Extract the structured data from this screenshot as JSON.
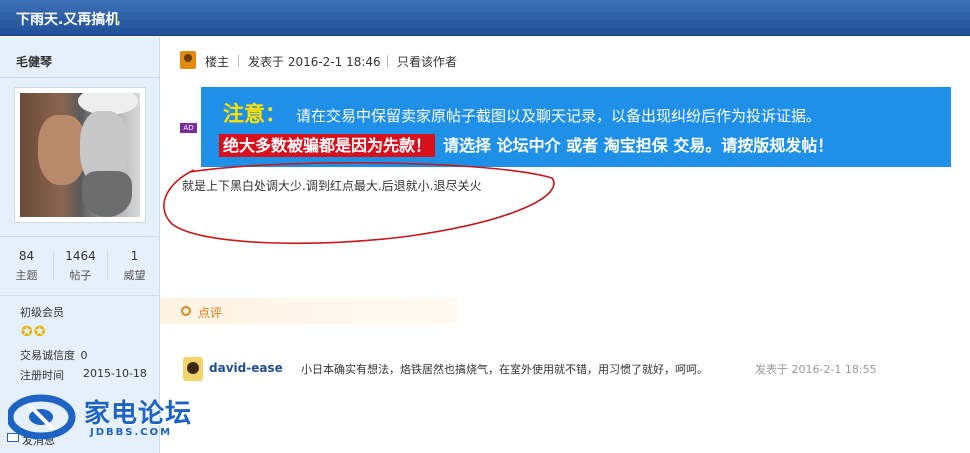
{
  "thread": {
    "title": "下雨天.又再搞机"
  },
  "author": {
    "name": "毛健琴",
    "stats": [
      {
        "value": "84",
        "label": "主题"
      },
      {
        "value": "1464",
        "label": "帖子"
      },
      {
        "value": "1",
        "label": "威望"
      }
    ],
    "level": "初级会员",
    "stars": "✪✪",
    "credit_label": "交易诚信度",
    "credit_value": "0",
    "reg_label": "注册时间",
    "reg_value": "2015-10-18",
    "send_message": "发消息"
  },
  "post_header": {
    "role": "楼主",
    "posted": "发表于 2016-2-1 18:46",
    "only_author": "只看该作者"
  },
  "ad_badge": "AD",
  "notice": {
    "heading": "注意：",
    "line1": "请在交易中保留卖家原帖子截图以及聊天记录，以备出现纠纷后作为投诉证据。",
    "warning": "绝大多数被骗都是因为先款！",
    "line2": "请选择 论坛中介 或者 淘宝担保 交易。请按版规发帖！",
    "bg_color": "#1e90e8",
    "heading_color": "#ffe000",
    "warning_color": "#d8101c"
  },
  "post_body": "就是上下黑白处调大少.调到红点最大.后退就小.退尽关火",
  "comment_section": {
    "label": "点评"
  },
  "comment": {
    "user": "david-ease",
    "text": "小日本确实有想法，烙铁居然也搞烧气，在室外使用就不错，用习惯了就好，呵呵。",
    "time": "发表于 2016-2-1 18:55"
  },
  "watermark": {
    "title": "家电论坛",
    "domain": "JDBBS.COM"
  }
}
